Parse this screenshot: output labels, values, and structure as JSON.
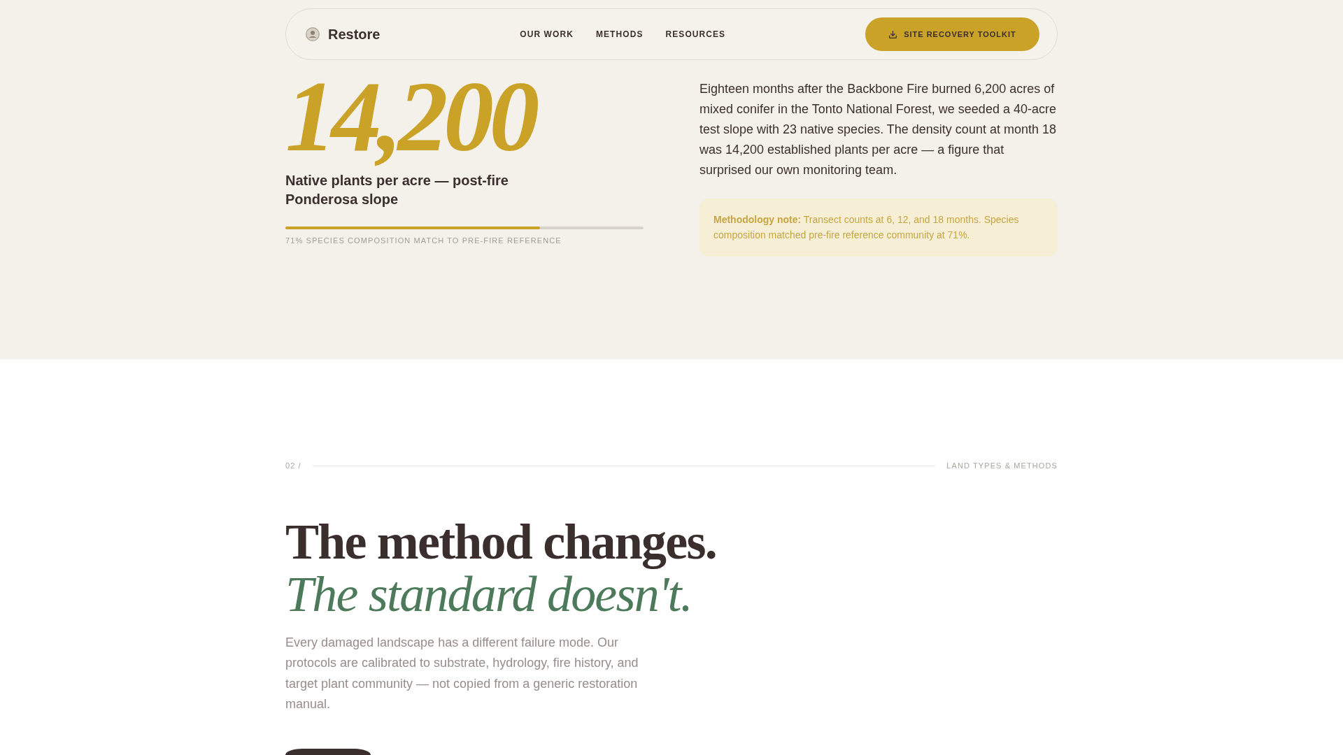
{
  "nav": {
    "brand": "Restore",
    "links": [
      "OUR WORK",
      "METHODS",
      "RESOURCES"
    ],
    "cta": "SITE RECOVERY TOOLKIT"
  },
  "stat": {
    "value": "14,200",
    "caption": "Native plants per acre — post-fire Ponderosa slope",
    "progress": {
      "level": 0.71,
      "label": "71% SPECIES COMPOSITION MATCH TO PRE-FIRE REFERENCE"
    }
  },
  "story": {
    "text": "Eighteen months after the Backbone Fire burned 6,200 acres of mixed conifer in the Tonto National Forest, we seeded a 40-acre test slope with 23 native species. The density count at month 18 was 14,200 established plants per acre — a figure that surprised our own monitoring team.",
    "note": "**Methodology note:** Transect counts at 6, 12, and 18 months. Species composition matched pre-fire reference community at 71%."
  },
  "section": {
    "number": "02 /",
    "label": "LAND TYPES & METHODS",
    "headline": "The method changes.",
    "headline_accent": "The standard doesn't.",
    "body": "Every damaged landscape has a different failure mode. Our protocols are calibrated to substrate, hydrology, fire history, and target plant community — not copied from a generic restoration manual."
  }
}
